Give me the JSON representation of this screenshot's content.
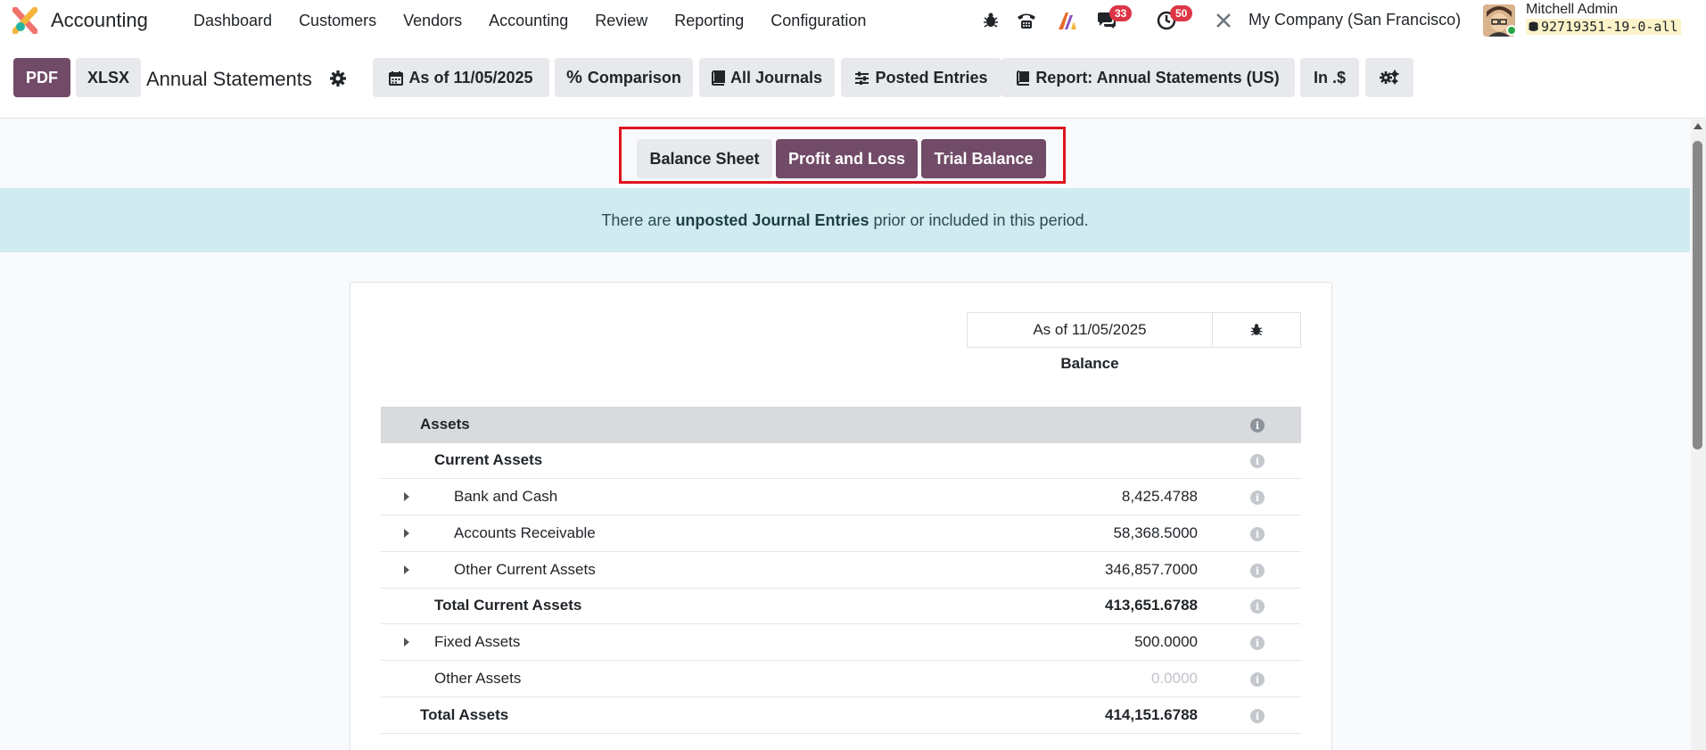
{
  "navbar": {
    "app_name": "Accounting",
    "menu": [
      "Dashboard",
      "Customers",
      "Vendors",
      "Accounting",
      "Review",
      "Reporting",
      "Configuration"
    ],
    "chat_badge": "33",
    "activity_badge": "50",
    "company": "My Company (San Francisco)",
    "user_name": "Mitchell Admin",
    "db_name": "92719351-19-0-all"
  },
  "control_panel": {
    "pdf_label": "PDF",
    "xlsx_label": "XLSX",
    "report_title": "Annual Statements",
    "filters": {
      "date": "As of 11/05/2025",
      "comparison": "Comparison",
      "journals": "All Journals",
      "entries": "Posted Entries",
      "report": "Report: Annual Statements (US)",
      "currency": "In .$"
    }
  },
  "variants": {
    "balance_sheet": "Balance Sheet",
    "profit_loss": "Profit and Loss",
    "trial_balance": "Trial Balance"
  },
  "alert": {
    "prefix": "There are ",
    "link": "unposted Journal Entries",
    "suffix": " prior or included in this period."
  },
  "table": {
    "column_date": "As of 11/05/2025",
    "column_label": "Balance",
    "rows": [
      {
        "label": "Assets",
        "value": ""
      },
      {
        "label": "Current Assets",
        "value": ""
      },
      {
        "label": "Bank and Cash",
        "value": "8,425.4788"
      },
      {
        "label": "Accounts Receivable",
        "value": "58,368.5000"
      },
      {
        "label": "Other Current Assets",
        "value": "346,857.7000"
      },
      {
        "label": "Total Current Assets",
        "value": "413,651.6788"
      },
      {
        "label": "Fixed Assets",
        "value": "500.0000"
      },
      {
        "label": "Other Assets",
        "value": "0.0000"
      },
      {
        "label": "Total Assets",
        "value": "414,151.6788"
      }
    ]
  },
  "colors": {
    "primary": "#714b67",
    "alert_bg": "#d0ecf0",
    "highlight_border": "#e0141e"
  }
}
